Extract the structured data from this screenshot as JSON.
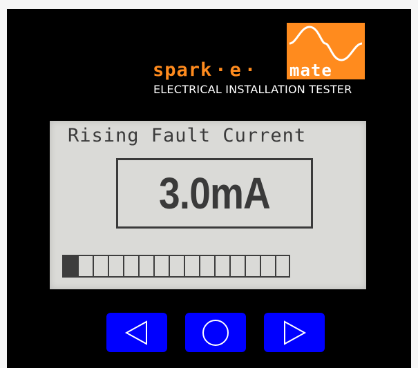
{
  "brand": {
    "word_1": "spark",
    "word_2": "e",
    "word_3": "mate",
    "separator": "·",
    "subtitle": "ELECTRICAL INSTALLATION TESTER",
    "accent_color": "#ff8b1e"
  },
  "display": {
    "title": "Rising Fault Current",
    "value": "3.0mA",
    "progress": {
      "segments": 15,
      "filled": 1,
      "fraction": 0.0667
    }
  },
  "controls": {
    "left": {
      "icon": "triangle-left-icon"
    },
    "center": {
      "icon": "circle-icon"
    },
    "right": {
      "icon": "triangle-right-icon"
    },
    "button_color": "#0000ff"
  }
}
